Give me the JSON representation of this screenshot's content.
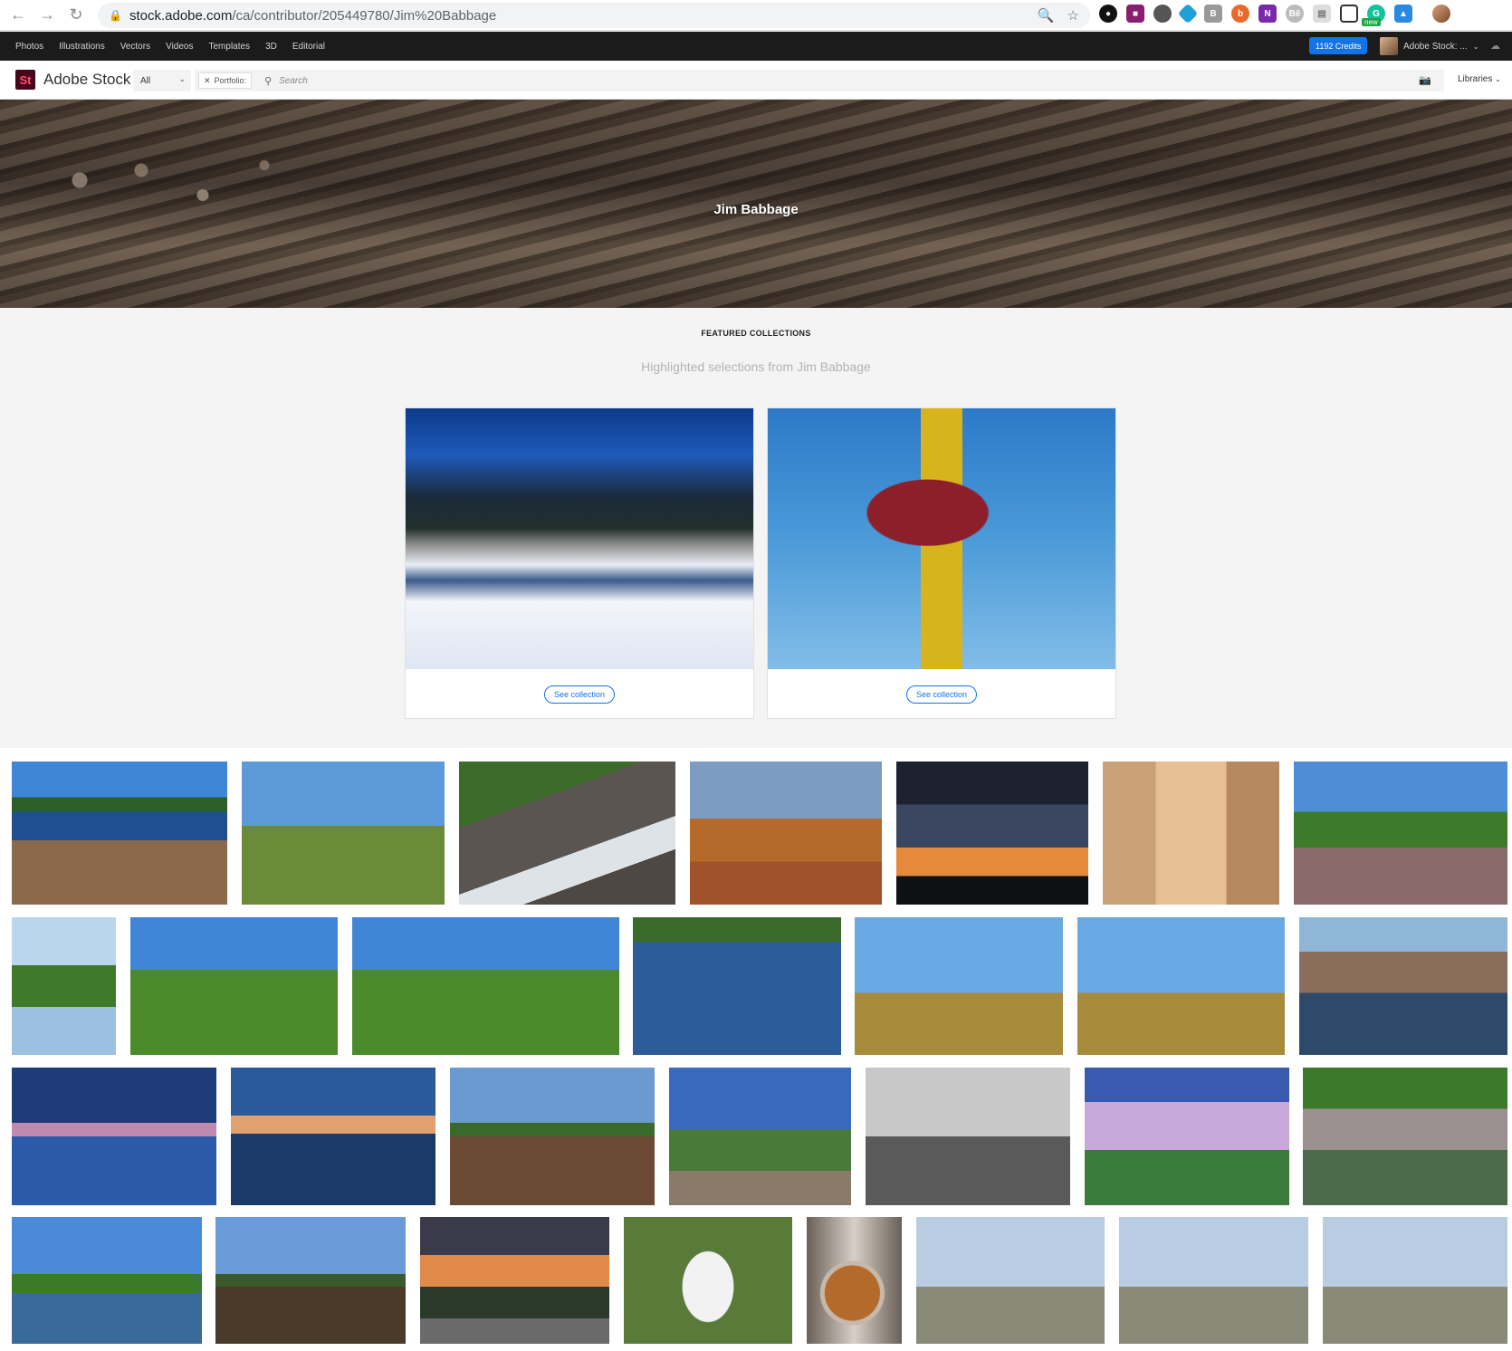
{
  "browser": {
    "url_host": "stock.adobe.com",
    "url_path": "/ca/contributor/205449780/Jim%20Babbage",
    "ext_new_badge": "new"
  },
  "topnav": {
    "items": [
      "Photos",
      "Illustrations",
      "Vectors",
      "Videos",
      "Templates",
      "3D",
      "Editorial"
    ],
    "credits": "1192 Credits",
    "account": "Adobe Stock: ..."
  },
  "searchbar": {
    "brand": "Adobe Stock",
    "logo_text": "St",
    "filter_value": "All",
    "chip_label": "Portfolio:",
    "placeholder": "Search",
    "libraries": "Libraries"
  },
  "hero": {
    "title": "Jim Babbage"
  },
  "featured": {
    "heading": "FEATURED COLLECTIONS",
    "subheading": "Highlighted selections from Jim Babbage",
    "cards": [
      {
        "button": "See collection"
      },
      {
        "button": "See collection"
      }
    ]
  }
}
